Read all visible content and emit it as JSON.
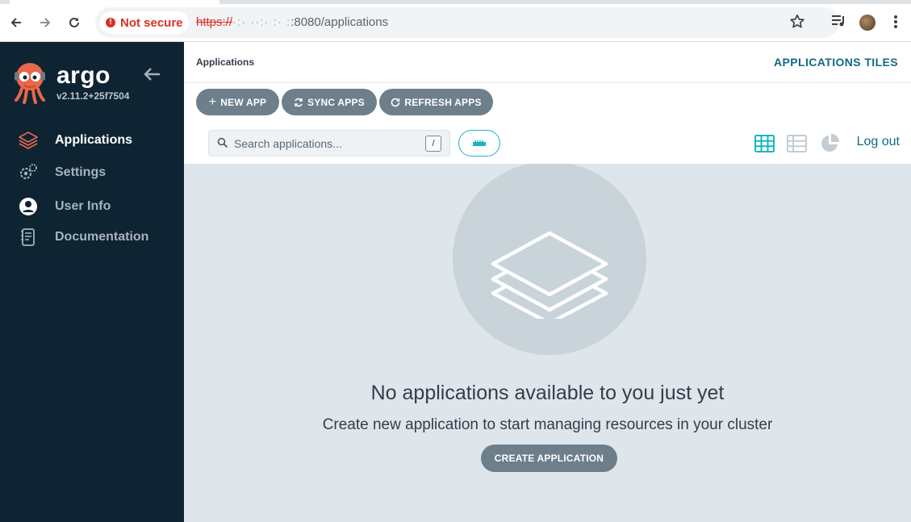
{
  "browser": {
    "security_label": "Not secure",
    "url_scheme": "https://",
    "url_host_obscured": "·:· ··:· :· :",
    "url_rest": ":8080/applications",
    "icons": [
      "back-arrow-icon",
      "forward-arrow-icon",
      "reload-icon",
      "star-icon",
      "media-control-icon",
      "profile-avatar",
      "more-vert-icon"
    ]
  },
  "sidebar": {
    "brand": "argo",
    "version": "v2.11.2+25f7504",
    "items": [
      {
        "label": "Applications",
        "icon": "layers-icon",
        "active": true
      },
      {
        "label": "Settings",
        "icon": "gears-icon",
        "active": false
      },
      {
        "label": "User Info",
        "icon": "user-circle-icon",
        "active": false
      },
      {
        "label": "Documentation",
        "icon": "book-icon",
        "active": false
      }
    ]
  },
  "header": {
    "breadcrumb": "Applications",
    "view_title": "APPLICATIONS TILES"
  },
  "toolbar": {
    "new_app": "NEW APP",
    "sync_apps": "SYNC APPS",
    "refresh_apps": "REFRESH APPS",
    "search_placeholder": "Search applications...",
    "search_value": "",
    "search_shortcut": "/",
    "logout": "Log out",
    "active_view": "tiles"
  },
  "empty_state": {
    "title": "No applications available to you just yet",
    "subtitle": "Create new application to start managing resources in your cluster",
    "cta": "CREATE APPLICATION"
  },
  "colors": {
    "sidebar_bg": "#0e2433",
    "accent_teal": "#116a83",
    "active_icon": "#19b5c2",
    "button_grey": "#6d7f8b",
    "main_bg": "#dee6eb",
    "logo_orange": "#e9674a"
  }
}
